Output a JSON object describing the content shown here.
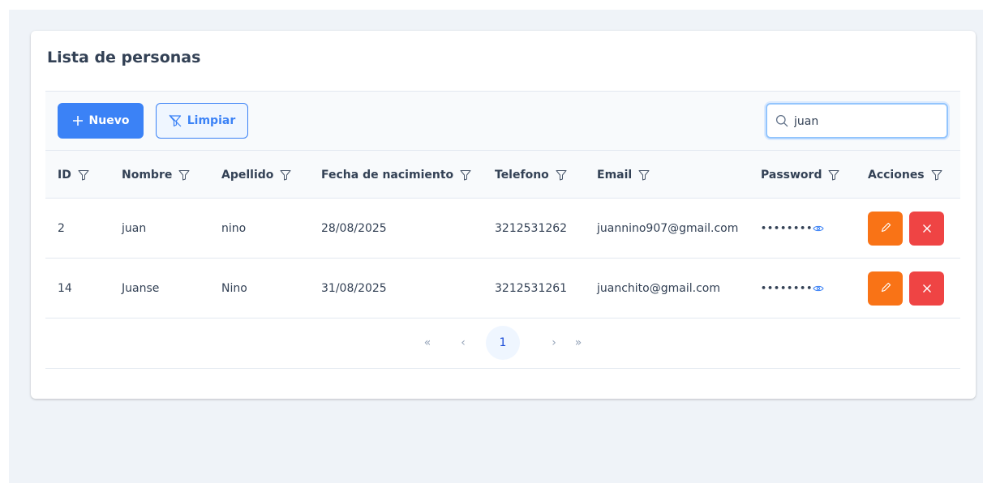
{
  "title": "Lista de personas",
  "toolbar": {
    "new_label": "Nuevo",
    "clear_label": "Limpiar",
    "search_value": "juan"
  },
  "table": {
    "columns": [
      "ID",
      "Nombre",
      "Apellido",
      "Fecha de nacimiento",
      "Telefono",
      "Email",
      "Password",
      "Acciones"
    ],
    "rows": [
      {
        "id": "2",
        "nombre": "juan",
        "apellido": "nino",
        "fecha": "28/08/2025",
        "telefono": "3212531262",
        "email": "juannino907@gmail.com",
        "password": "••••••••"
      },
      {
        "id": "14",
        "nombre": "Juanse",
        "apellido": "Nino",
        "fecha": "31/08/2025",
        "telefono": "3212531261",
        "email": "juanchito@gmail.com",
        "password": "••••••••"
      }
    ]
  },
  "pagination": {
    "current_page": "1",
    "first_glyph": "«",
    "prev_glyph": "‹",
    "next_glyph": "›",
    "last_glyph": "»"
  },
  "icons": {
    "new": "plus-icon",
    "clear": "filter-slash-icon",
    "search": "search-icon",
    "column_filter": "filter-icon",
    "reveal": "eye-icon",
    "edit": "pencil-icon",
    "delete": "times-icon"
  },
  "colors": {
    "primary": "#3b82f6",
    "edit": "#f97316",
    "delete": "#ef4444",
    "page_background": "#eff3f8"
  }
}
